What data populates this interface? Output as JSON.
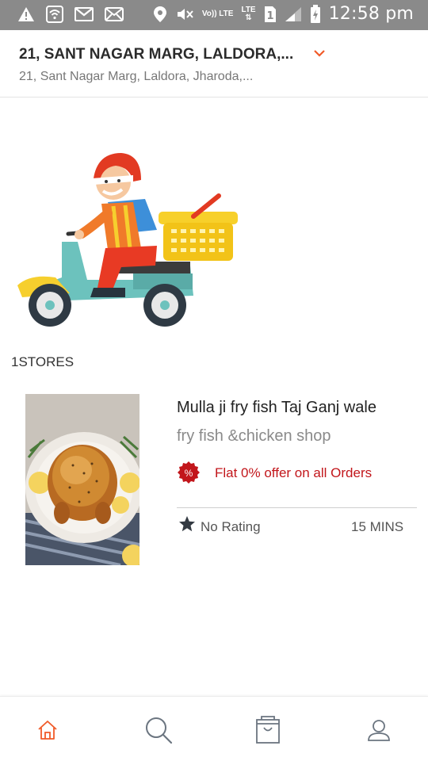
{
  "status_bar": {
    "time": "12:58 pm",
    "network": "LTE",
    "sim": "1",
    "volte": "Vo)) LTE",
    "icons": [
      "warning-icon",
      "wifi-icon",
      "gmail-icon",
      "mail-icon",
      "location-icon",
      "mute-icon",
      "volte-icon",
      "lte-icon",
      "sim-icon",
      "signal-icon",
      "battery-charging-icon"
    ]
  },
  "header": {
    "address_title": "21, SANT NAGAR MARG, LALDORA,...",
    "address_subtitle": "21, Sant Nagar Marg, Laldora, Jharoda,...",
    "chevron_icon": "chevron-down-icon"
  },
  "illustration": "delivery-scooter-illustration",
  "stores": {
    "count_label": "1STORES",
    "items": [
      {
        "name": "Mulla ji fry fish Taj Ganj wale",
        "category": "fry fish &chicken shop",
        "offer_icon": "%",
        "offer_text": "Flat 0% offer on all Orders",
        "rating_text": "No Rating",
        "eta_text": "15 MINS"
      }
    ]
  },
  "colors": {
    "accent": "#f05a28",
    "offer_red": "#c2161b",
    "status_bar": "#8a8a8a"
  },
  "bottom_nav": {
    "items": [
      {
        "icon": "home-icon",
        "active": true
      },
      {
        "icon": "search-icon",
        "active": false
      },
      {
        "icon": "bag-icon",
        "active": false
      },
      {
        "icon": "profile-icon",
        "active": false
      }
    ]
  }
}
